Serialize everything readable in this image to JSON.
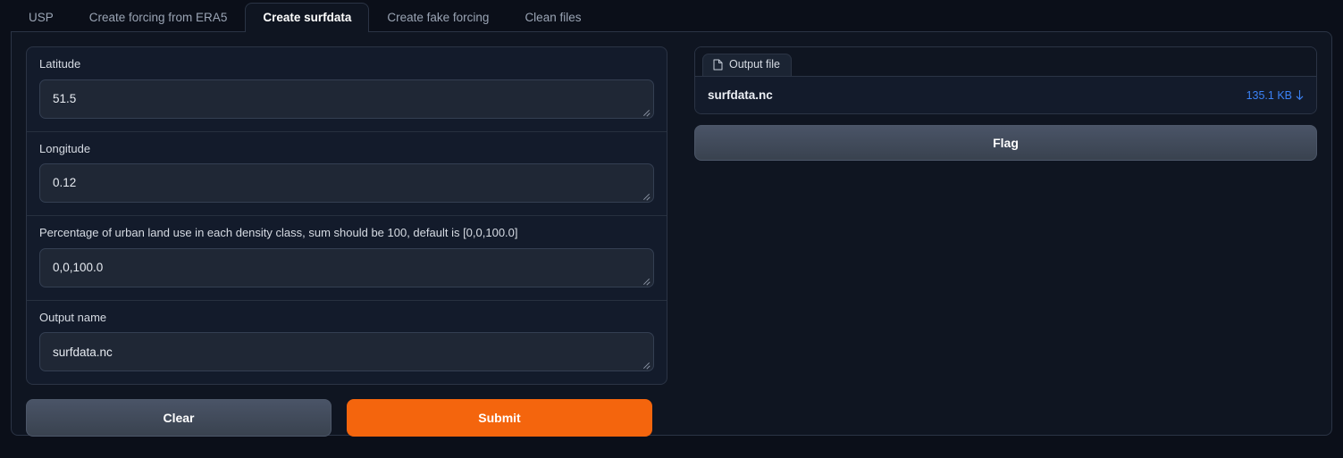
{
  "tabs": [
    {
      "label": "USP",
      "active": false
    },
    {
      "label": "Create forcing from ERA5",
      "active": false
    },
    {
      "label": "Create surfdata",
      "active": true
    },
    {
      "label": "Create fake forcing",
      "active": false
    },
    {
      "label": "Clean files",
      "active": false
    }
  ],
  "form": {
    "fields": [
      {
        "label": "Latitude",
        "value": "51.5"
      },
      {
        "label": "Longitude",
        "value": "0.12"
      },
      {
        "label": "Percentage of urban land use in each density class, sum should be 100, default is [0,0,100.0]",
        "value": "0,0,100.0"
      },
      {
        "label": "Output name",
        "value": "surfdata.nc"
      }
    ],
    "clear_label": "Clear",
    "submit_label": "Submit"
  },
  "output": {
    "tab_label": "Output file",
    "file_icon": "document-icon",
    "file_name": "surfdata.nc",
    "file_size": "135.1 KB",
    "download_icon": "download-arrow-icon",
    "flag_label": "Flag"
  },
  "colors": {
    "page_background": "#0b0f19",
    "panel_background": "#0f1521",
    "group_background": "#131b2b",
    "input_background": "#1f2735",
    "border": "#2b3445",
    "accent_orange": "#f4650d",
    "link_blue": "#3b82f6",
    "text_primary": "#e6eaf0",
    "text_muted": "#9aa4b4"
  }
}
